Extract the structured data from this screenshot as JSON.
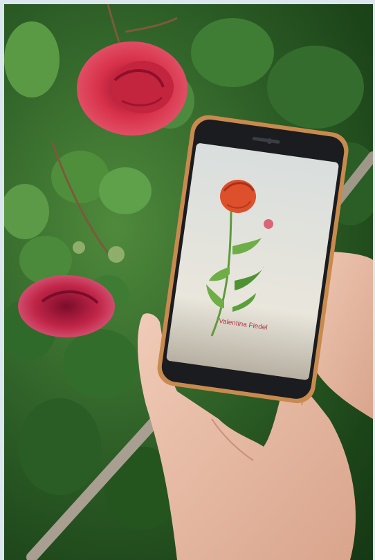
{
  "image": {
    "kind": "photograph",
    "scene": [
      "hands",
      "smartphone",
      "rose bush"
    ]
  },
  "phone_screen": {
    "illustration": "red-rose-drawing",
    "caption": "Valentina Fiedel"
  },
  "colors": {
    "rose_red": "#d8314a",
    "leaf_green": "#3c7a33",
    "phone_frame": "#c98a4e",
    "screen_bg": "#e7e5dd",
    "skin": "#e6b9a3",
    "caption_red": "#b3363f"
  }
}
